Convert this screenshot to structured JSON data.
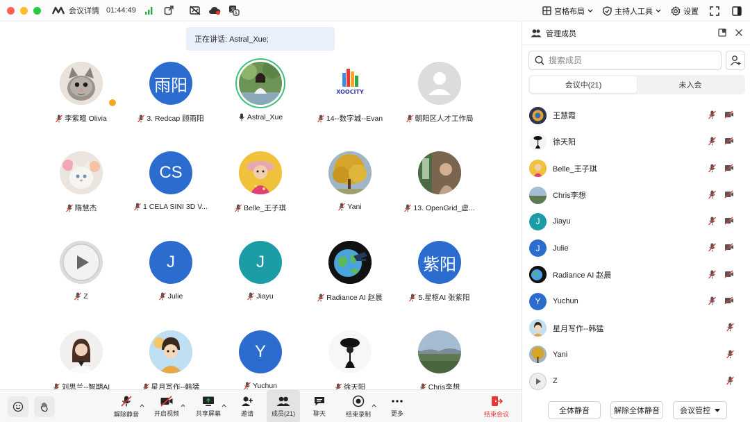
{
  "titlebar": {
    "app_title": "会议详情",
    "elapsed": "01:44:49",
    "layout_label": "宫格布局",
    "host_tools_label": "主持人工具",
    "settings_label": "设置"
  },
  "main": {
    "speaker_banner": "正在讲话: Astral_Xue;",
    "tiles": [
      {
        "name": "李紫暄 Olivia",
        "muted": true
      },
      {
        "name": "3. Redcap 顾雨阳",
        "muted": true,
        "avatar_text": "雨阳"
      },
      {
        "name": "Astral_Xue",
        "muted": false
      },
      {
        "name": "14--数字城--Evan",
        "muted": true,
        "logo_text": "XOOCITY"
      },
      {
        "name": "朝阳区人才工作局",
        "muted": true
      },
      {
        "name": "隋慧杰",
        "muted": true
      },
      {
        "name": "1 CELA SINI 3D V...",
        "muted": true,
        "avatar_text": "CS"
      },
      {
        "name": "Belle_王子琪",
        "muted": true
      },
      {
        "name": "Yani",
        "muted": true
      },
      {
        "name": "13. OpenGrid_虚...",
        "muted": true
      },
      {
        "name": "Z",
        "muted": true
      },
      {
        "name": "Julie",
        "muted": true,
        "avatar_text": "J"
      },
      {
        "name": "Jiayu",
        "muted": true,
        "avatar_text": "J"
      },
      {
        "name": "Radiance AI 赵晨",
        "muted": true
      },
      {
        "name": "5.星枢AI 张紫阳",
        "muted": true,
        "avatar_text": "紫阳"
      },
      {
        "name": "刘思兰--智期AI",
        "muted": true
      },
      {
        "name": "星月写作--韩猛",
        "muted": true
      },
      {
        "name": "Yuchun",
        "muted": true,
        "avatar_text": "Y"
      },
      {
        "name": "徐天阳",
        "muted": true
      },
      {
        "name": "Chris李想",
        "muted": true
      }
    ]
  },
  "toolbar": {
    "unmute": "解除静音",
    "start_video": "开启视频",
    "share_screen": "共享屏幕",
    "invite": "邀请",
    "members": "成员(21)",
    "chat": "聊天",
    "stop_recording": "结束录制",
    "more": "更多",
    "end_meeting": "结束会议"
  },
  "panel": {
    "title": "管理成员",
    "search_placeholder": "搜索成员",
    "tab_in_meeting": "会议中(21)",
    "tab_not_joined": "未入会",
    "members": [
      {
        "name": "王慧霞",
        "video": true
      },
      {
        "name": "徐天阳",
        "video": true
      },
      {
        "name": "Belle_王子琪",
        "video": true
      },
      {
        "name": "Chris李想",
        "video": true
      },
      {
        "name": "Jiayu",
        "video": true,
        "avatar_text": "J"
      },
      {
        "name": "Julie",
        "video": true,
        "avatar_text": "J"
      },
      {
        "name": "Radiance AI 赵晨",
        "video": true
      },
      {
        "name": "Yuchun",
        "video": true,
        "avatar_text": "Y"
      },
      {
        "name": "星月写作--韩猛",
        "video": false
      },
      {
        "name": "Yani",
        "video": false
      },
      {
        "name": "Z",
        "video": false
      }
    ],
    "mute_all": "全体静音",
    "unmute_all": "解除全体静音",
    "meeting_control": "会议管控"
  },
  "colors": {
    "accent_blue": "#2c6ccf",
    "teal": "#1c9ca4",
    "mute_red": "#e53935",
    "speaker_ring": "#3cc07c"
  }
}
